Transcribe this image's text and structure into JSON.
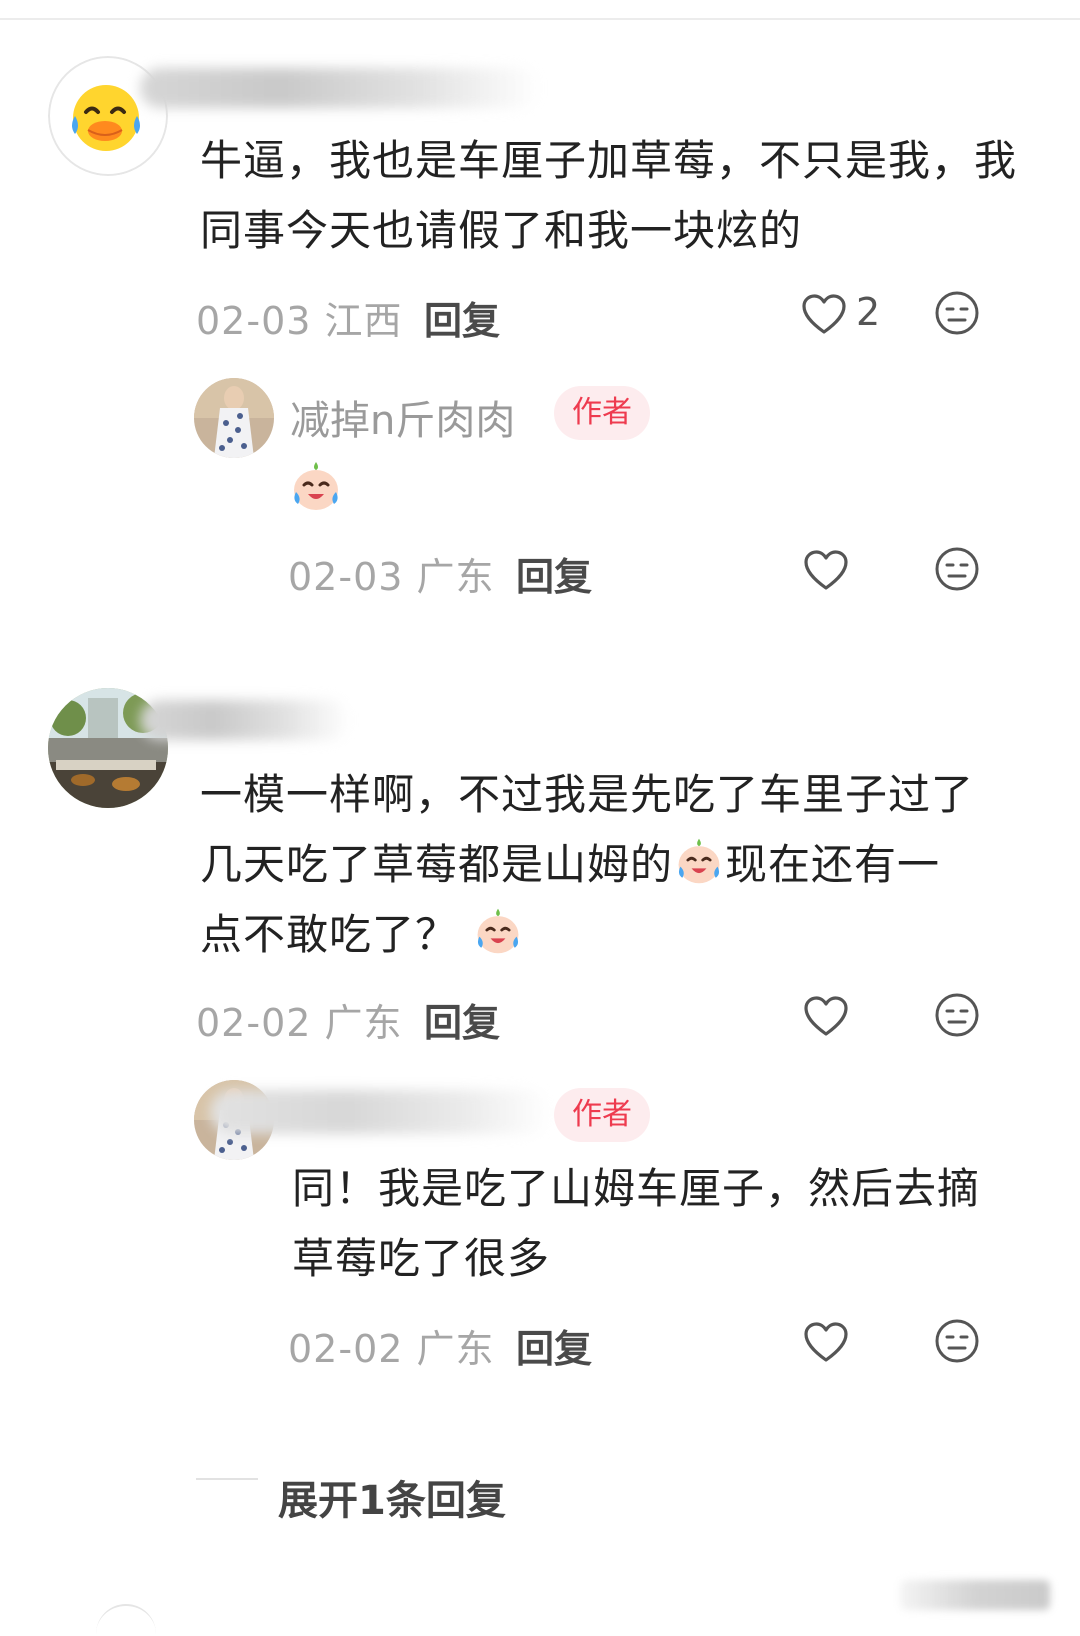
{
  "comments": [
    {
      "text": "牛逼，我也是车厘子加草莓，不只是我，我同事今天也请假了和我一块炫的",
      "date": "02-03",
      "region": "江西",
      "reply_label": "回复",
      "like_count": "2",
      "replies": [
        {
          "username": "减掉n斤肉肉",
          "author_tag": "作者",
          "date": "02-03",
          "region": "广东",
          "reply_label": "回复"
        }
      ]
    },
    {
      "text_lines": [
        "一模一样啊，不过我是先吃了车里子过了",
        "几天吃了草莓都是山姆的",
        "现在还有一",
        "点不敢吃了？"
      ],
      "date": "02-02",
      "region": "广东",
      "reply_label": "回复",
      "replies": [
        {
          "author_tag": "作者",
          "text": "同！我是吃了山姆车厘子，然后去摘草莓吃了很多",
          "date": "02-02",
          "region": "广东",
          "reply_label": "回复"
        }
      ]
    }
  ],
  "expand_replies_label": "展开1条回复",
  "colors": {
    "author_tag_bg": "#fdecee",
    "author_tag_text": "#ee3b4f",
    "meta_gray": "#a6a6a6"
  }
}
